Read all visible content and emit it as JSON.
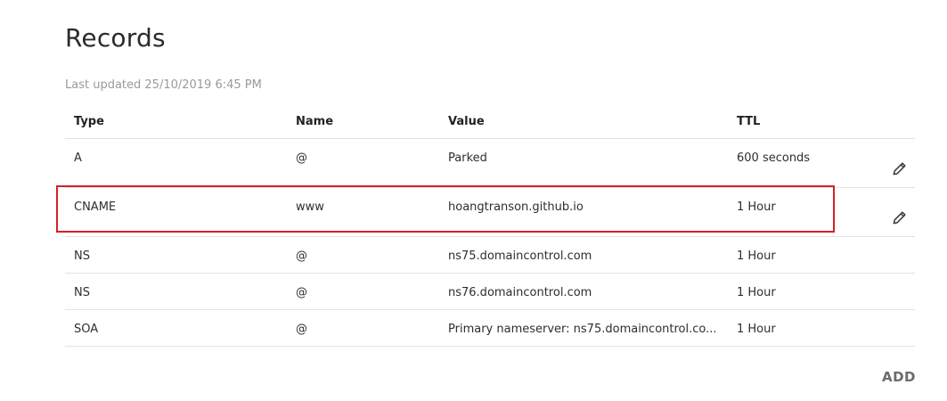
{
  "page": {
    "title": "Records",
    "last_updated": "Last updated 25/10/2019 6:45 PM"
  },
  "table": {
    "headers": {
      "type": "Type",
      "name": "Name",
      "value": "Value",
      "ttl": "TTL"
    },
    "rows": [
      {
        "type": "A",
        "name": "@",
        "value": "Parked",
        "ttl": "600 seconds",
        "editable": true
      },
      {
        "type": "CNAME",
        "name": "www",
        "value": "hoangtranson.github.io",
        "ttl": "1 Hour",
        "editable": true,
        "highlighted": true
      },
      {
        "type": "NS",
        "name": "@",
        "value": "ns75.domaincontrol.com",
        "ttl": "1 Hour",
        "editable": false
      },
      {
        "type": "NS",
        "name": "@",
        "value": "ns76.domaincontrol.com",
        "ttl": "1 Hour",
        "editable": false
      },
      {
        "type": "SOA",
        "name": "@",
        "value": "Primary nameserver: ns75.domaincontrol.co...",
        "ttl": "1 Hour",
        "editable": false
      }
    ]
  },
  "actions": {
    "add_label": "ADD",
    "edit_icon": "pencil-icon"
  },
  "colors": {
    "highlight_border": "#d0232b",
    "muted_text": "#9a9a9a",
    "divider": "#e3e3e3"
  }
}
